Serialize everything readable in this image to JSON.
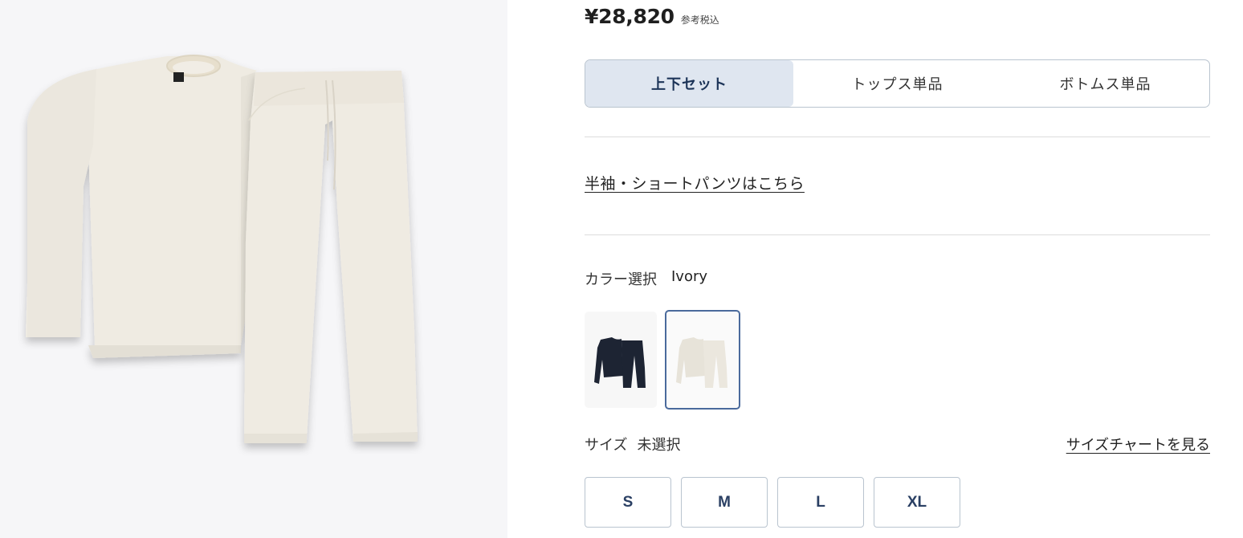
{
  "product": {
    "price": "¥28,820",
    "tax_note": "参考税込"
  },
  "set_options": [
    {
      "label": "上下セット",
      "active": true
    },
    {
      "label": "トップス単品",
      "active": false
    },
    {
      "label": "ボトムス単品",
      "active": false
    }
  ],
  "short_link": "半袖・ショートパンツはこちら",
  "color": {
    "label": "カラー選択",
    "value": "Ivory",
    "swatches": [
      {
        "name": "Navy",
        "color": "#1d2433",
        "selected": false
      },
      {
        "name": "Ivory",
        "color": "#ece8df",
        "selected": true
      }
    ]
  },
  "size": {
    "label": "サイズ",
    "value": "未選択",
    "chart_link": "サイズチャートを見る",
    "options": [
      "S",
      "M",
      "L",
      "XL"
    ]
  },
  "colors": {
    "accent": "#1c3458",
    "selected_border": "#4a6a9c",
    "active_segment_bg": "#dfe6f0"
  }
}
